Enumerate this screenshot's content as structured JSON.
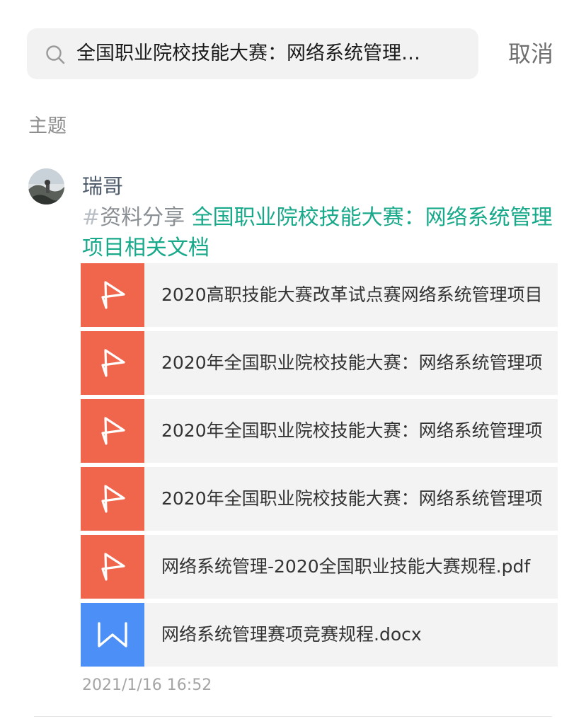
{
  "search": {
    "query": "全国职业院校技能大赛：网络系统管理…",
    "icon": "search-icon"
  },
  "cancel_label": "取消",
  "section_title": "主题",
  "post": {
    "author": "瑞哥",
    "avatar_icon": "user-avatar",
    "hash": "#",
    "tag": "资料分享",
    "title": "全国职业院校技能大赛：网络系统管理项目相关文档",
    "files": [
      {
        "type": "pdf",
        "icon": "pdf-file-icon",
        "name": "2020高职技能大赛改革试点赛网络系统管理项目"
      },
      {
        "type": "pdf",
        "icon": "pdf-file-icon",
        "name": "2020年全国职业院校技能大赛：网络系统管理项"
      },
      {
        "type": "pdf",
        "icon": "pdf-file-icon",
        "name": "2020年全国职业院校技能大赛：网络系统管理项"
      },
      {
        "type": "pdf",
        "icon": "pdf-file-icon",
        "name": "2020年全国职业院校技能大赛：网络系统管理项"
      },
      {
        "type": "pdf",
        "icon": "pdf-file-icon",
        "name": "网络系统管理-2020全国职业技能大赛规程.pdf"
      },
      {
        "type": "doc",
        "icon": "word-file-icon",
        "name": "网络系统管理赛项竞赛规程.docx"
      }
    ],
    "timestamp": "2021/1/16 16:52"
  },
  "colors": {
    "accent_green": "#18a88a",
    "pdf_red": "#f0664c",
    "word_blue": "#4c8ff6"
  }
}
